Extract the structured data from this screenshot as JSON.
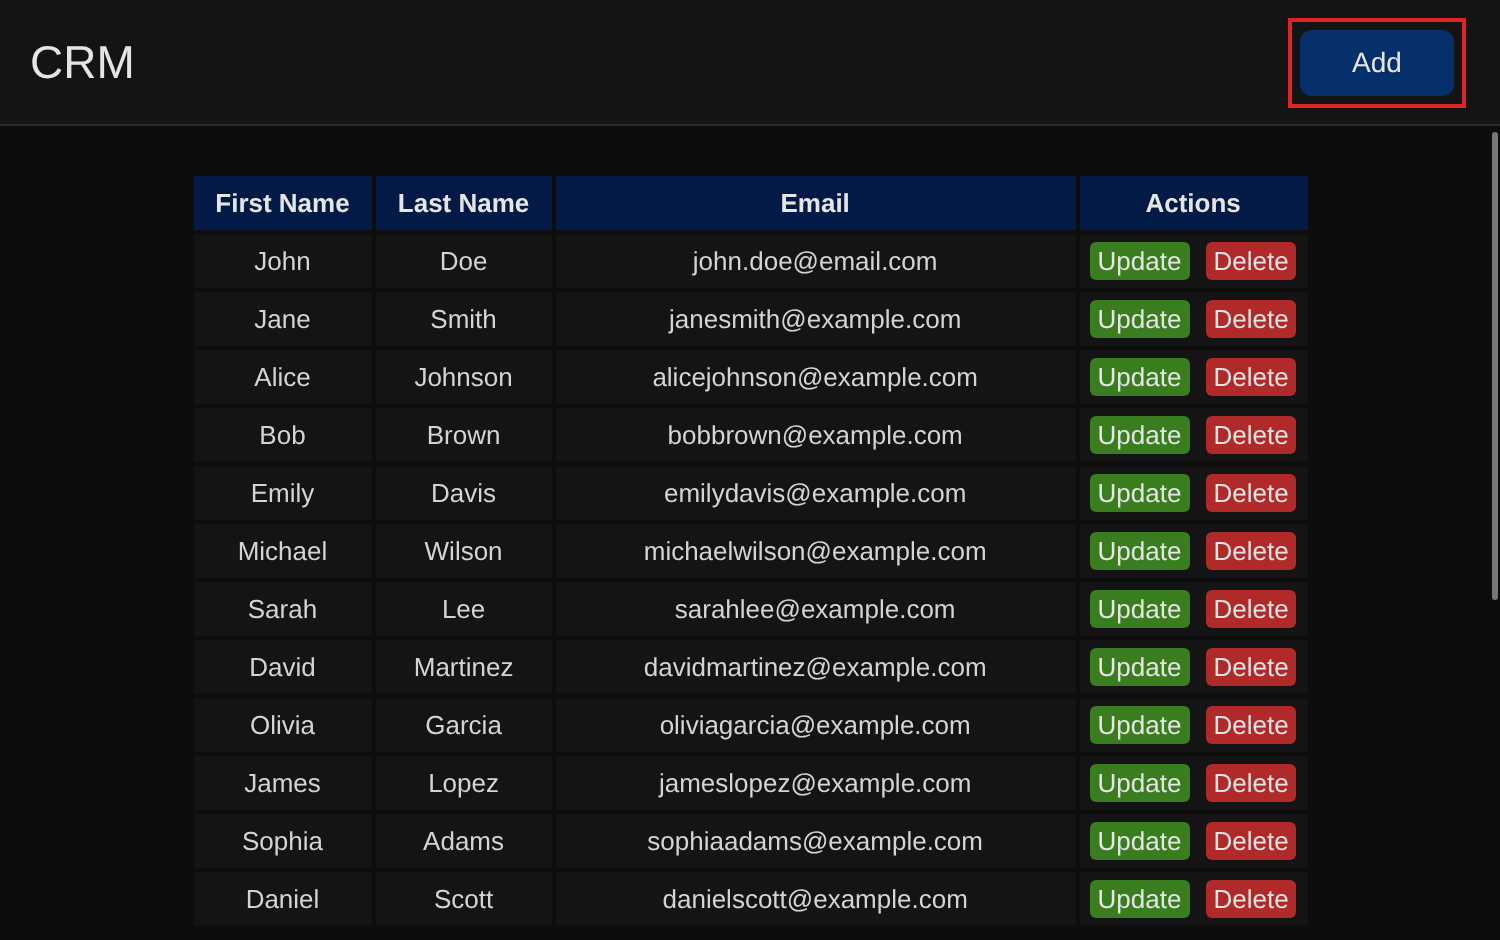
{
  "header": {
    "title": "CRM",
    "add_button": {
      "label": "Add",
      "highlighted": true
    }
  },
  "table": {
    "columns": [
      "First Name",
      "Last Name",
      "Email",
      "Actions"
    ],
    "rows": [
      {
        "first_name": "John",
        "last_name": "Doe",
        "email": "john.doe@email.com",
        "actions": [
          "Update",
          "Delete"
        ]
      },
      {
        "first_name": "Jane",
        "last_name": "Smith",
        "email": "janesmith@example.com",
        "actions": [
          "Update",
          "Delete"
        ]
      },
      {
        "first_name": "Alice",
        "last_name": "Johnson",
        "email": "alicejohnson@example.com",
        "actions": [
          "Update",
          "Delete"
        ]
      },
      {
        "first_name": "Bob",
        "last_name": "Brown",
        "email": "bobbrown@example.com",
        "actions": [
          "Update",
          "Delete"
        ]
      },
      {
        "first_name": "Emily",
        "last_name": "Davis",
        "email": "emilydavis@example.com",
        "actions": [
          "Update",
          "Delete"
        ]
      },
      {
        "first_name": "Michael",
        "last_name": "Wilson",
        "email": "michaelwilson@example.com",
        "actions": [
          "Update",
          "Delete"
        ]
      },
      {
        "first_name": "Sarah",
        "last_name": "Lee",
        "email": "sarahlee@example.com",
        "actions": [
          "Update",
          "Delete"
        ]
      },
      {
        "first_name": "David",
        "last_name": "Martinez",
        "email": "davidmartinez@example.com",
        "actions": [
          "Update",
          "Delete"
        ]
      },
      {
        "first_name": "Olivia",
        "last_name": "Garcia",
        "email": "oliviagarcia@example.com",
        "actions": [
          "Update",
          "Delete"
        ]
      },
      {
        "first_name": "James",
        "last_name": "Lopez",
        "email": "jameslopez@example.com",
        "actions": [
          "Update",
          "Delete"
        ]
      },
      {
        "first_name": "Sophia",
        "last_name": "Adams",
        "email": "sophiaadams@example.com",
        "actions": [
          "Update",
          "Delete"
        ]
      },
      {
        "first_name": "Daniel",
        "last_name": "Scott",
        "email": "danielscott@example.com",
        "actions": [
          "Update",
          "Delete"
        ]
      }
    ]
  }
}
